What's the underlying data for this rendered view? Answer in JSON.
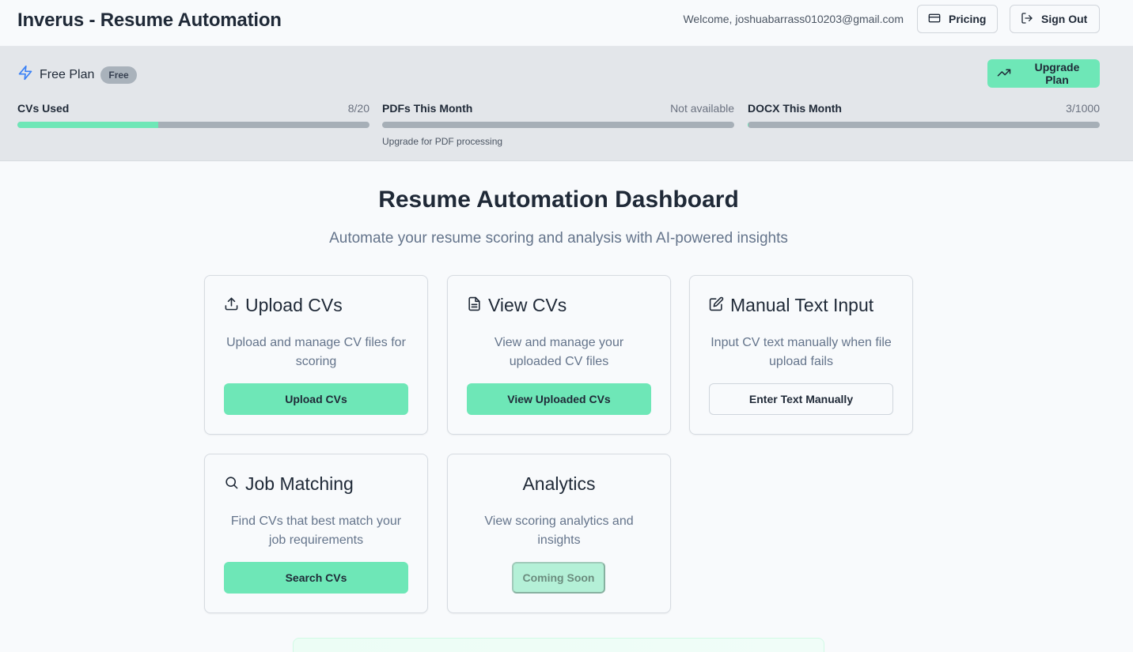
{
  "header": {
    "title": "Inverus - Resume Automation",
    "welcome": "Welcome, joshuabarrass010203@gmail.com",
    "pricing_label": "Pricing",
    "signout_label": "Sign Out"
  },
  "plan": {
    "name": "Free Plan",
    "badge": "Free",
    "upgrade_label": "Upgrade Plan",
    "meters": [
      {
        "label": "CVs Used",
        "value": "8/20",
        "fraction": 0.4
      },
      {
        "label": "PDFs This Month",
        "value": "Not available",
        "fraction": 0,
        "note": "Upgrade for PDF processing"
      },
      {
        "label": "DOCX This Month",
        "value": "3/1000",
        "fraction": 0.003
      }
    ]
  },
  "main": {
    "title": "Resume Automation Dashboard",
    "subtitle": "Automate your resume scoring and analysis with AI-powered insights",
    "cards": [
      {
        "title": "Upload CVs",
        "description": "Upload and manage CV files for scoring",
        "button": "Upload CVs",
        "icon": "upload-icon"
      },
      {
        "title": "View CVs",
        "description": "View and manage your uploaded CV files",
        "button": "View Uploaded CVs",
        "icon": "file-text-icon"
      },
      {
        "title": "Manual Text Input",
        "description": "Input CV text manually when file upload fails",
        "button": "Enter Text Manually",
        "icon": "edit-icon"
      },
      {
        "title": "Job Matching",
        "description": "Find CVs that best match your job requirements",
        "button": "Search CVs",
        "icon": "search-icon"
      },
      {
        "title": "Analytics",
        "description": "View scoring analytics and insights",
        "button": "Coming Soon"
      }
    ]
  },
  "colors": {
    "accent": "#6ee7b7",
    "plan_band": "#e3e6ea",
    "icon_blue": "#3b82f6"
  }
}
